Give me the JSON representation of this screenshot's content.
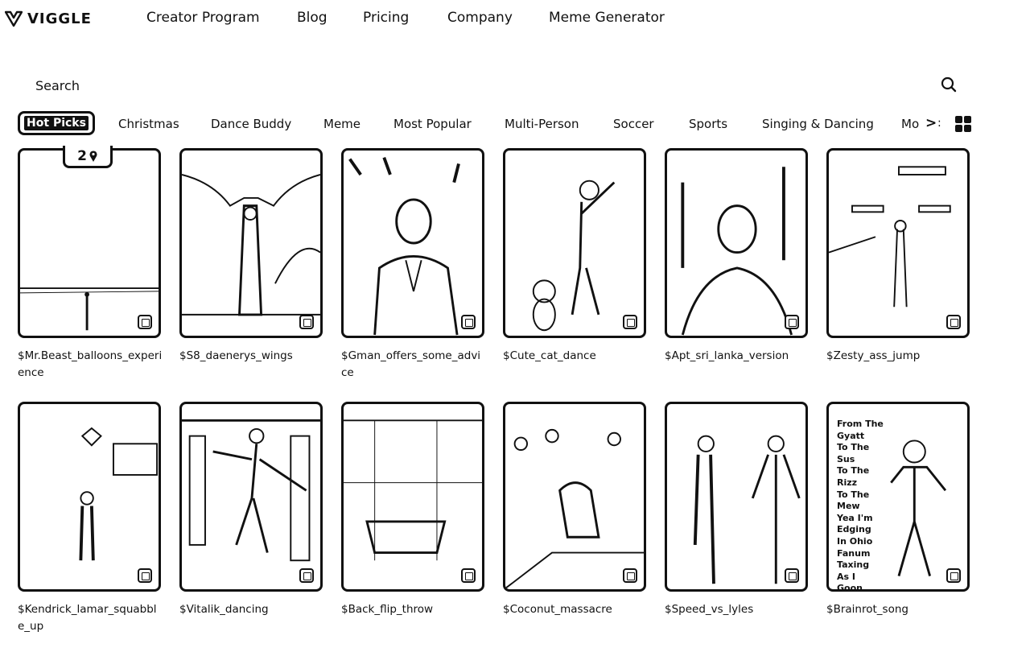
{
  "header": {
    "logo_text": "VIGGLE",
    "nav": [
      "Creator Program",
      "Blog",
      "Pricing",
      "Company",
      "Meme Generator"
    ]
  },
  "search": {
    "placeholder": "Search"
  },
  "categories": {
    "active": "Hot Picks",
    "items": [
      "Christmas",
      "Dance Buddy",
      "Meme",
      "Most Popular",
      "Multi-Person",
      "Soccer",
      "Sports",
      "Singing & Dancing",
      "Mo"
    ],
    "more_label": ">",
    "ellipsis": ":"
  },
  "cards": [
    {
      "title": "$Mr.Beast_balloons_experience",
      "pin": "2"
    },
    {
      "title": "$S8_daenerys_wings"
    },
    {
      "title": "$Gman_offers_some_advice"
    },
    {
      "title": "$Cute_cat_dance"
    },
    {
      "title": "$Apt_sri_lanka_version"
    },
    {
      "title": "$Zesty_ass_jump"
    },
    {
      "title": "$Kendrick_lamar_squabble_up"
    },
    {
      "title": "$Vitalik_dancing"
    },
    {
      "title": "$Back_flip_throw"
    },
    {
      "title": "$Coconut_massacre"
    },
    {
      "title": "$Speed_vs_lyles"
    },
    {
      "title": "$Brainrot_song",
      "overlay": [
        "From The",
        "Gyatt",
        "To The",
        "Sus",
        "To The",
        "Rizz",
        "To The",
        "Mew",
        "Yea I'm",
        "Edging",
        "In Ohio",
        "Fanum",
        "Taxing",
        "As I",
        "Goon"
      ]
    }
  ],
  "icons": {
    "logo": "viggle-logo-icon",
    "search": "search-icon",
    "grid": "grid-view-icon",
    "pin": "pin-icon",
    "badge": "template-icon"
  }
}
